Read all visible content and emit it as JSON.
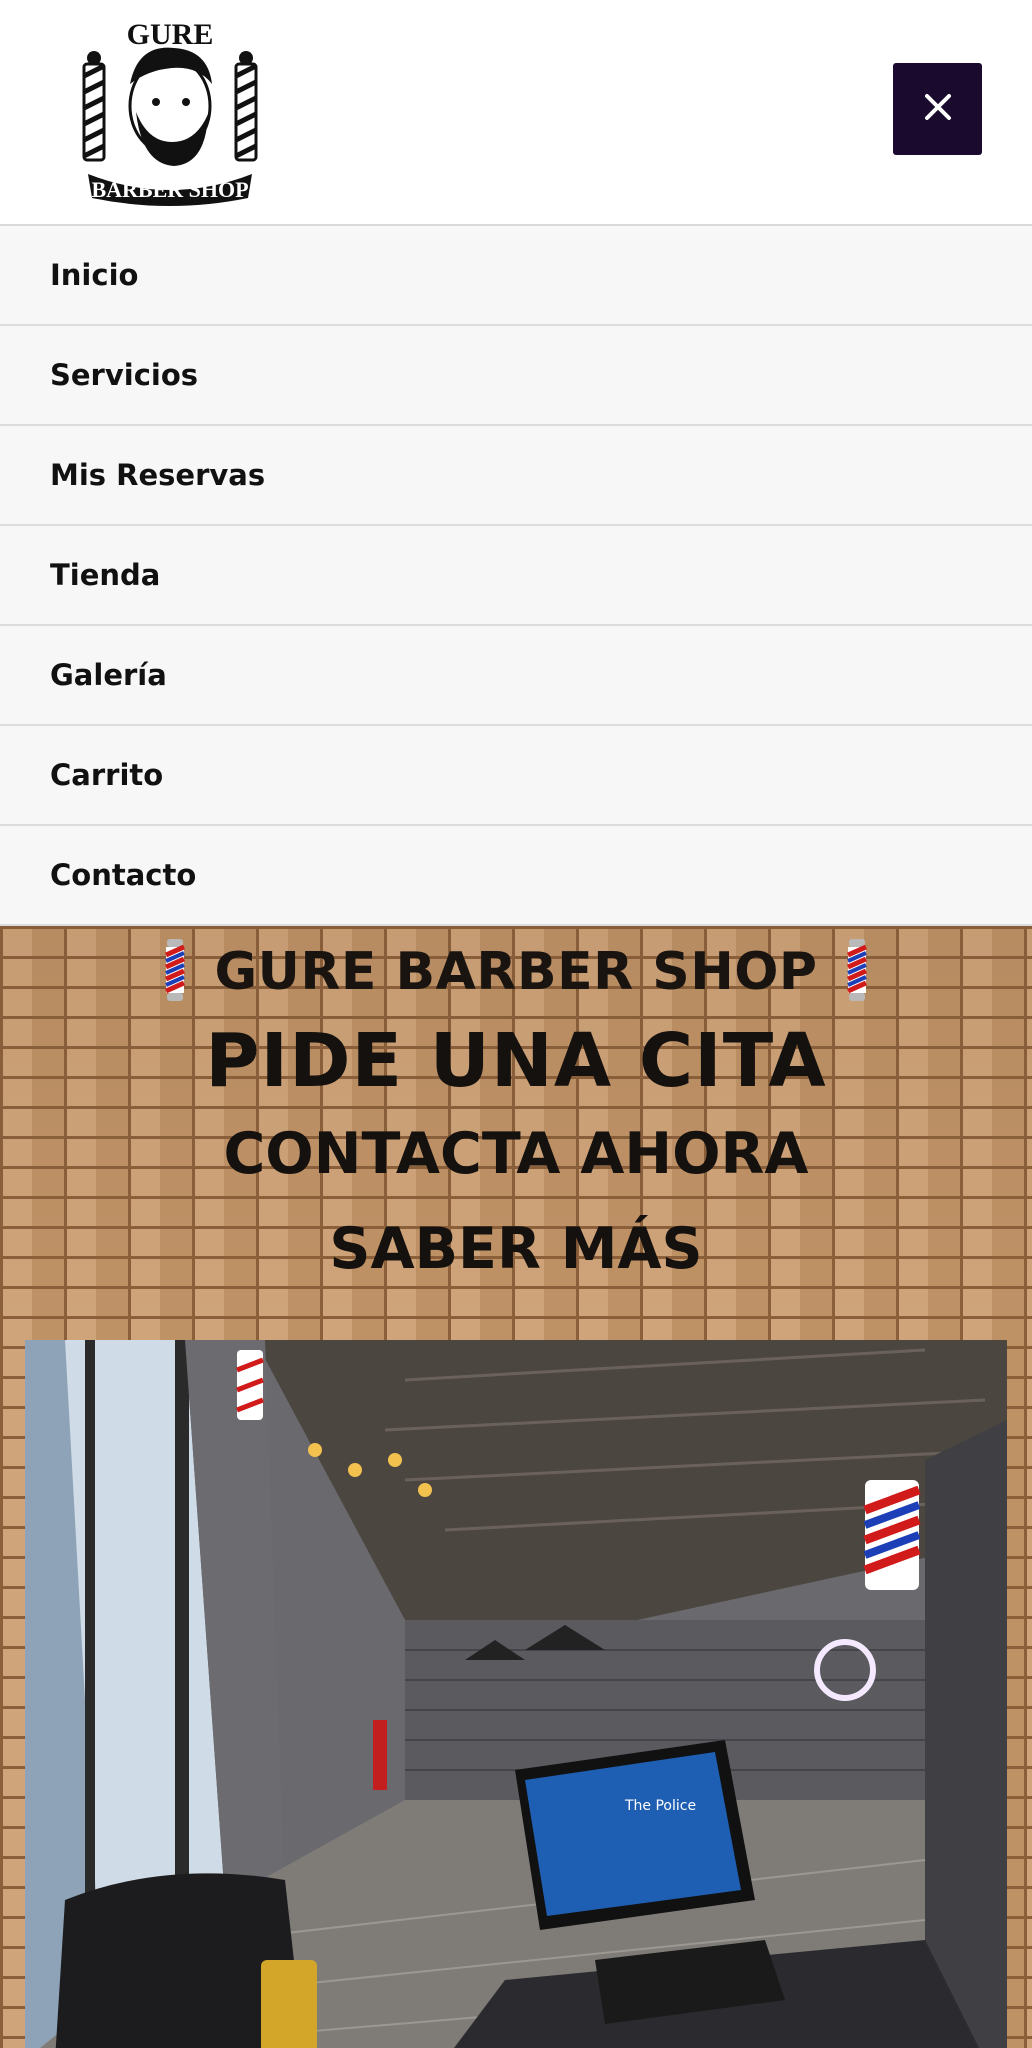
{
  "header": {
    "logo": {
      "top_text": "GURE",
      "bottom_text": "BARBER SHOP"
    },
    "close_icon": "close-icon"
  },
  "nav": {
    "items": [
      {
        "label": "Inicio"
      },
      {
        "label": "Servicios"
      },
      {
        "label": "Mis Reservas"
      },
      {
        "label": "Tienda"
      },
      {
        "label": "Galería"
      },
      {
        "label": "Carrito"
      },
      {
        "label": "Contacto"
      }
    ]
  },
  "hero": {
    "title": "GURE BARBER SHOP",
    "cta_main": "PIDE UNA CITA",
    "cta_contact": "CONTACTA AHORA",
    "cta_more": "SABER MÁS",
    "photo_screen_text": "The Police"
  },
  "colors": {
    "close_button_bg": "#1a0b2e",
    "nav_bg": "#f7f7f7",
    "brick": "#c99a6b",
    "text_dark": "#15110e"
  }
}
